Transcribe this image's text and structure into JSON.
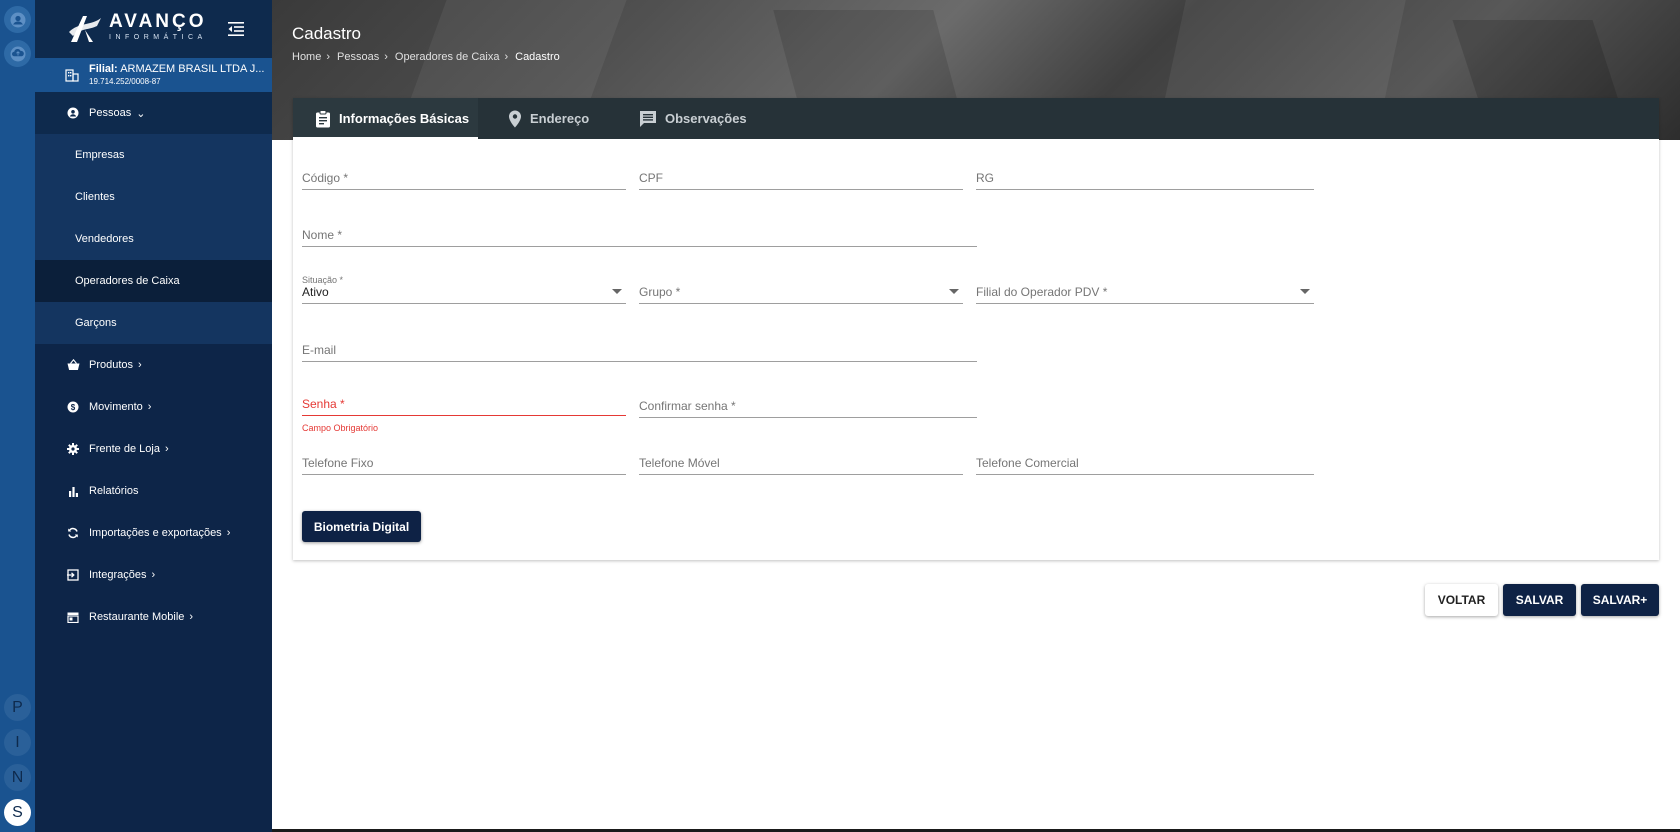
{
  "rail": {
    "letters": [
      "P",
      "I",
      "N",
      "S"
    ]
  },
  "sidebar": {
    "logo_main": "AVANÇO",
    "logo_sub": "INFORMÁTICA",
    "filial_label": "Filial:",
    "filial_name": "ARMAZEM BRASIL LTDA J...",
    "filial_cnpj": "19.714.252/0008-87",
    "items": [
      {
        "label": "Pessoas",
        "icon": "person-icon"
      },
      {
        "label": "Produtos",
        "icon": "basket-icon"
      },
      {
        "label": "Movimento",
        "icon": "dollar-icon"
      },
      {
        "label": "Frente de Loja",
        "icon": "gear-icon"
      },
      {
        "label": "Relatórios",
        "icon": "bar-chart-icon"
      },
      {
        "label": "Importações e exportações",
        "icon": "sync-icon"
      },
      {
        "label": "Integrações",
        "icon": "login-icon"
      },
      {
        "label": "Restaurante Mobile",
        "icon": "store-icon"
      }
    ],
    "sub_items": [
      "Empresas",
      "Clientes",
      "Vendedores",
      "Operadores de Caixa",
      "Garçons"
    ]
  },
  "header": {
    "title": "Cadastro",
    "breadcrumb": [
      "Home",
      "Pessoas",
      "Operadores de Caixa",
      "Cadastro"
    ]
  },
  "tabs": [
    {
      "label": "Informações Básicas",
      "icon": "clipboard-icon"
    },
    {
      "label": "Endereço",
      "icon": "location-pin-icon"
    },
    {
      "label": "Observações",
      "icon": "comment-icon"
    }
  ],
  "form": {
    "codigo": "Código *",
    "cpf": "CPF",
    "rg": "RG",
    "nome": "Nome *",
    "situacao_label": "Situação *",
    "situacao_value": "Ativo",
    "grupo": "Grupo *",
    "filial_operador": "Filial do Operador PDV *",
    "email": "E-mail",
    "senha": "Senha *",
    "senha_error": "Campo Obrigatório",
    "confirmar_senha": "Confirmar senha *",
    "telefone_fixo": "Telefone Fixo",
    "telefone_movel": "Telefone Móvel",
    "telefone_comercial": "Telefone Comercial",
    "biometria": "Biometria Digital"
  },
  "actions": {
    "voltar": "VOLTAR",
    "salvar": "SALVAR",
    "salvar_plus": "SALVAR+"
  },
  "colors": {
    "sidebar_bg": "#0d2548",
    "rail_bg": "#1a5390",
    "primary_button": "#0e2245",
    "tabs_bg": "#263238",
    "error": "#e53935"
  }
}
